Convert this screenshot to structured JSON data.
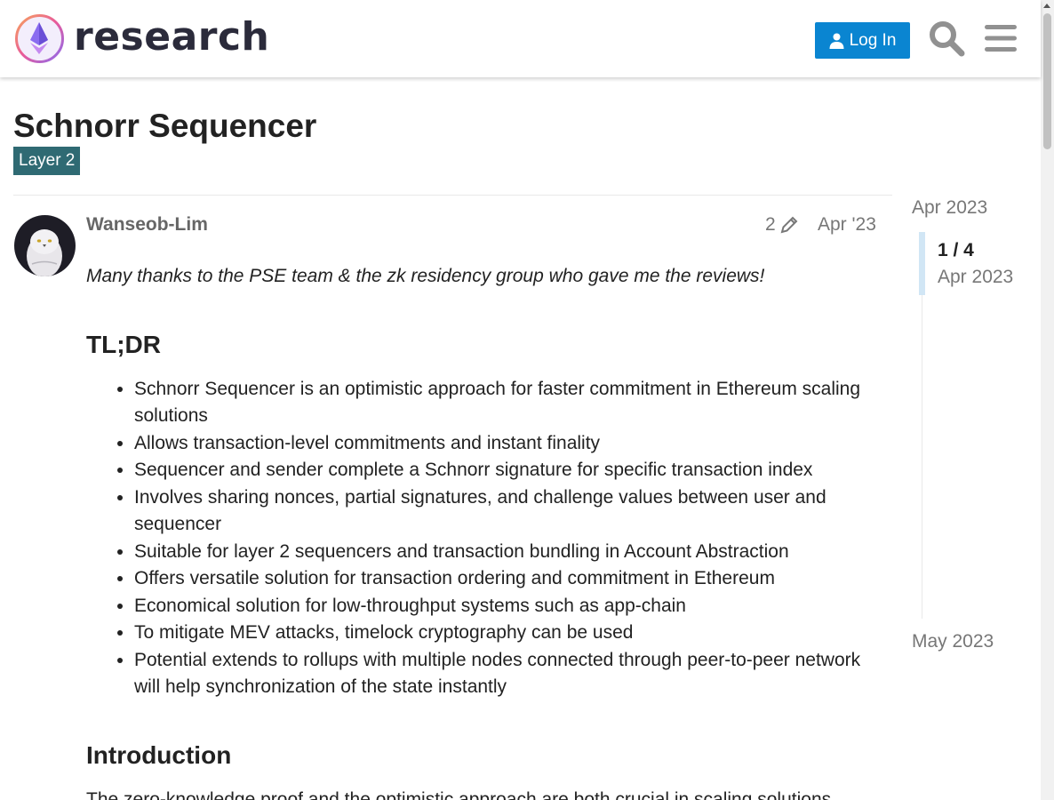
{
  "header": {
    "site_name": "research",
    "login_label": "Log In",
    "icons": [
      "ethereum-research-logo",
      "user-icon",
      "search-icon",
      "hamburger-menu-icon"
    ]
  },
  "topic": {
    "title": "Schnorr Sequencer",
    "category": "Layer 2",
    "category_color": "#2f6a73"
  },
  "post": {
    "author": "Wanseob-Lim",
    "edit_count": "2",
    "date": "Apr '23",
    "thanks": "Many thanks to the PSE team & the zk residency group who gave me the reviews!",
    "tldr_heading": "TL;DR",
    "tldr_items": [
      "Schnorr Sequencer is an optimistic approach for faster commitment in Ethereum scaling solutions",
      "Allows transaction-level commitments and instant finality",
      "Sequencer and sender complete a Schnorr signature for specific transaction index",
      "Involves sharing nonces, partial signatures, and challenge values between user and sequencer",
      "Suitable for layer 2 sequencers and transaction bundling in Account Abstraction",
      "Offers versatile solution for transaction ordering and commitment in Ethereum",
      "Economical solution for low-throughput systems such as app-chain",
      "To mitigate MEV attacks, timelock cryptography can be used",
      "Potential extends to rollups with multiple nodes connected through peer-to-peer network will help synchronization of the state instantly"
    ],
    "intro_heading": "Introduction",
    "intro_text": "The zero-knowledge proof and the optimistic approach are both crucial in scaling solutions"
  },
  "timeline": {
    "start_date": "Apr 2023",
    "position": "1 / 4",
    "position_date": "Apr 2023",
    "end_date": "May 2023"
  },
  "colors": {
    "accent": "#0a85d1",
    "muted_text": "#777777"
  }
}
